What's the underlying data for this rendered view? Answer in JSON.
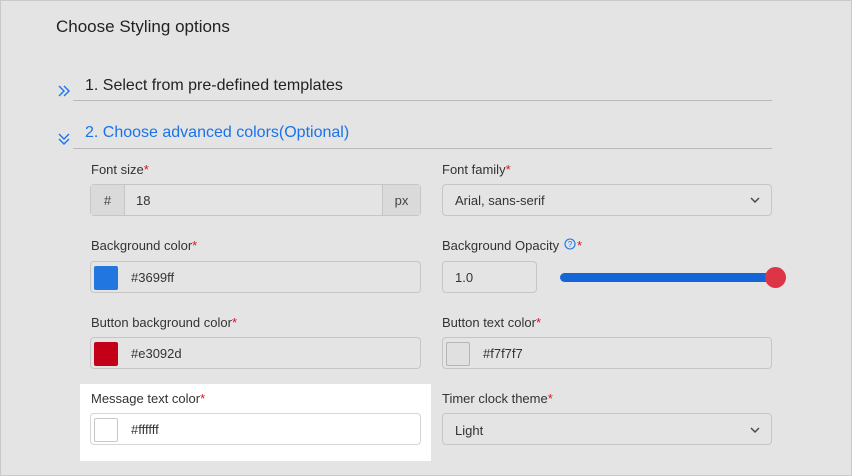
{
  "page_title": "Choose Styling options",
  "sections": {
    "templates": {
      "title": "1. Select from pre-defined templates",
      "icon": "chevrons-right-icon",
      "state": "collapsed"
    },
    "advanced": {
      "title": "2. Choose advanced colors(Optional)",
      "icon": "chevrons-down-icon",
      "state": "expanded",
      "accent": "#1a73e8"
    }
  },
  "fields": {
    "font_size": {
      "label": "Font size",
      "required_mark": "*",
      "prefix": "#",
      "value": "18",
      "suffix": "px"
    },
    "font_family": {
      "label": "Font family",
      "required_mark": "*",
      "value": "Arial, sans-serif"
    },
    "bg_color": {
      "label": "Background color",
      "required_mark": "*",
      "value": "#3699ff",
      "swatch": "#2176e0"
    },
    "bg_opacity": {
      "label": "Background Opacity",
      "required_mark": "*",
      "value": "1.0",
      "slider_fraction": 1.0
    },
    "btn_bg_color": {
      "label": "Button background color",
      "required_mark": "*",
      "value": "#e3092d",
      "swatch": "#c40018"
    },
    "btn_text_color": {
      "label": "Button text color",
      "required_mark": "*",
      "value": "#f7f7f7",
      "swatch": "#e0e0e0"
    },
    "msg_text_color": {
      "label": "Message text color",
      "required_mark": "*",
      "value": "#ffffff",
      "swatch": "#ffffff"
    },
    "timer_theme": {
      "label": "Timer clock theme",
      "required_mark": "*",
      "value": "Light"
    }
  },
  "colors": {
    "required": "#d6122a",
    "slider_track": "#1565d8",
    "slider_thumb": "#dc3545",
    "link_blue": "#1a73e8"
  }
}
